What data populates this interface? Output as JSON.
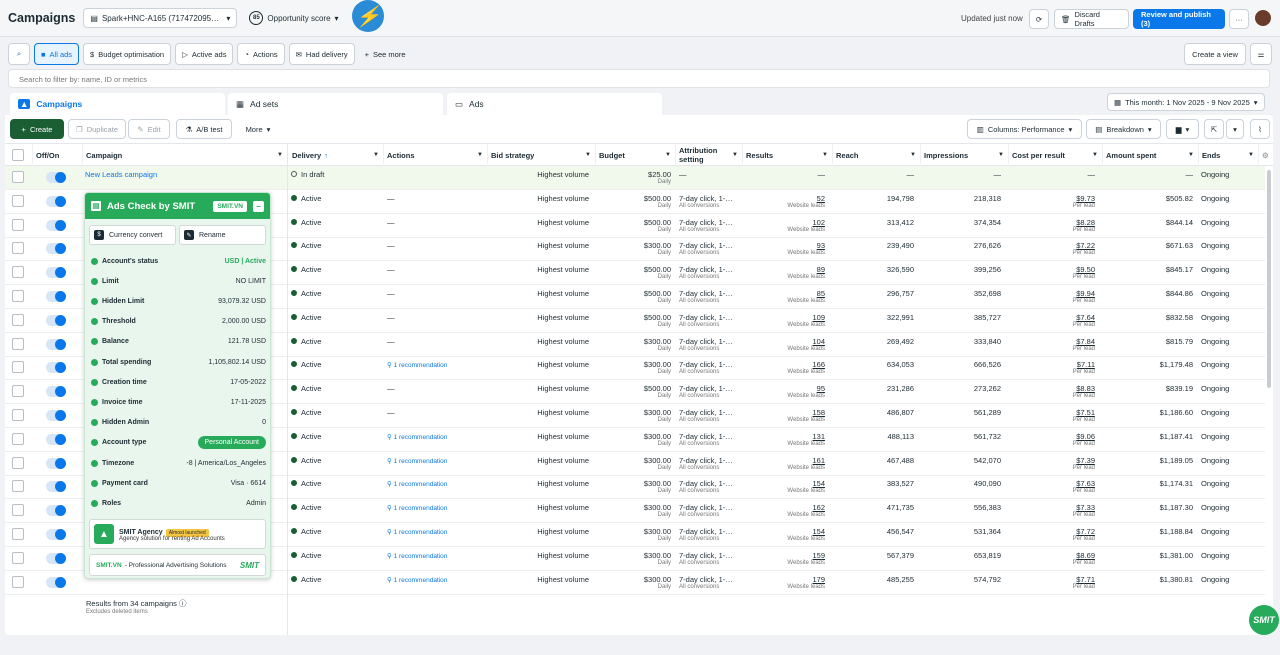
{
  "topbar": {
    "title": "Campaigns",
    "account": "Spark+HNC-A165 (717472095…",
    "opportunity_score_value": "85",
    "opportunity_score_label": "Opportunity score",
    "updated": "Updated just now",
    "discard": "Discard Drafts",
    "review": "Review and publish (3)",
    "more": "···"
  },
  "filters": {
    "all_ads": "All ads",
    "budget_opt": "Budget optimisation",
    "active_ads": "Active ads",
    "actions": "Actions",
    "had_delivery": "Had delivery",
    "see_more": "See more",
    "create_view": "Create a view"
  },
  "search": {
    "placeholder": "Search to filter by: name, ID or metrics"
  },
  "tabs": {
    "campaigns": "Campaigns",
    "adsets": "Ad sets",
    "ads": "Ads"
  },
  "date_range": "This month: 1 Nov 2025 - 9 Nov 2025",
  "toolbar": {
    "create": "Create",
    "duplicate": "Duplicate",
    "edit": "Edit",
    "ab_test": "A/B test",
    "more": "More",
    "columns": "Columns: Performance",
    "breakdown": "Breakdown"
  },
  "columns": {
    "offon": "Off/On",
    "campaign": "Campaign",
    "delivery": "Delivery",
    "actions": "Actions",
    "bid_strategy": "Bid strategy",
    "budget": "Budget",
    "attribution": "Attribution setting",
    "results": "Results",
    "reach": "Reach",
    "impressions": "Impressions",
    "cost_per_result": "Cost per result",
    "amount_spent": "Amount spent",
    "ends": "Ends"
  },
  "rows": [
    {
      "campaign": "New Leads campaign",
      "delivery": "In draft",
      "action": "",
      "bid": "Highest volume",
      "budget": "$25.00",
      "budget_period": "Daily",
      "attribution": "—",
      "attribution_sub": "",
      "results": "—",
      "results_sub": "",
      "reach": "—",
      "impressions": "—",
      "cpr": "—",
      "cpr_sub": "",
      "spent": "—",
      "ends": "Ongoing"
    },
    {
      "campaign": "",
      "delivery": "Active",
      "action": "—",
      "bid": "Highest volume",
      "budget": "$500.00",
      "budget_period": "Daily",
      "attribution": "7-day click, 1-…",
      "attribution_sub": "All conversions",
      "results": "52",
      "results_sub": "Website leads",
      "reach": "194,798",
      "impressions": "218,318",
      "cpr": "$9.73",
      "cpr_sub": "Per lead",
      "spent": "$505.82",
      "ends": "Ongoing"
    },
    {
      "campaign": "",
      "delivery": "Active",
      "action": "—",
      "bid": "Highest volume",
      "budget": "$500.00",
      "budget_period": "Daily",
      "attribution": "7-day click, 1-…",
      "attribution_sub": "All conversions",
      "results": "102",
      "results_sub": "Website leads",
      "reach": "313,412",
      "impressions": "374,354",
      "cpr": "$8.28",
      "cpr_sub": "Per lead",
      "spent": "$844.14",
      "ends": "Ongoing"
    },
    {
      "campaign": "",
      "delivery": "Active",
      "action": "—",
      "bid": "Highest volume",
      "budget": "$300.00",
      "budget_period": "Daily",
      "attribution": "7-day click, 1-…",
      "attribution_sub": "All conversions",
      "results": "93",
      "results_sub": "Website leads",
      "reach": "239,490",
      "impressions": "276,626",
      "cpr": "$7.22",
      "cpr_sub": "Per lead",
      "spent": "$671.63",
      "ends": "Ongoing"
    },
    {
      "campaign": "",
      "delivery": "Active",
      "action": "—",
      "bid": "Highest volume",
      "budget": "$500.00",
      "budget_period": "Daily",
      "attribution": "7-day click, 1-…",
      "attribution_sub": "All conversions",
      "results": "89",
      "results_sub": "Website leads",
      "reach": "326,590",
      "impressions": "399,256",
      "cpr": "$9.50",
      "cpr_sub": "Per lead",
      "spent": "$845.17",
      "ends": "Ongoing"
    },
    {
      "campaign": "",
      "delivery": "Active",
      "action": "—",
      "bid": "Highest volume",
      "budget": "$500.00",
      "budget_period": "Daily",
      "attribution": "7-day click, 1-…",
      "attribution_sub": "All conversions",
      "results": "85",
      "results_sub": "Website leads",
      "reach": "296,757",
      "impressions": "352,698",
      "cpr": "$9.94",
      "cpr_sub": "Per lead",
      "spent": "$844.86",
      "ends": "Ongoing"
    },
    {
      "campaign": "",
      "delivery": "Active",
      "action": "—",
      "bid": "Highest volume",
      "budget": "$500.00",
      "budget_period": "Daily",
      "attribution": "7-day click, 1-…",
      "attribution_sub": "All conversions",
      "results": "109",
      "results_sub": "Website leads",
      "reach": "322,991",
      "impressions": "385,727",
      "cpr": "$7.64",
      "cpr_sub": "Per lead",
      "spent": "$832.58",
      "ends": "Ongoing"
    },
    {
      "campaign": "",
      "delivery": "Active",
      "action": "—",
      "bid": "Highest volume",
      "budget": "$300.00",
      "budget_period": "Daily",
      "attribution": "7-day click, 1-…",
      "attribution_sub": "All conversions",
      "results": "104",
      "results_sub": "Website leads",
      "reach": "269,492",
      "impressions": "333,840",
      "cpr": "$7.84",
      "cpr_sub": "Per lead",
      "spent": "$815.79",
      "ends": "Ongoing"
    },
    {
      "campaign": "",
      "delivery": "Active",
      "action": "1 recommendation",
      "bid": "Highest volume",
      "budget": "$300.00",
      "budget_period": "Daily",
      "attribution": "7-day click, 1-…",
      "attribution_sub": "All conversions",
      "results": "166",
      "results_sub": "Website leads",
      "reach": "634,053",
      "impressions": "666,526",
      "cpr": "$7.11",
      "cpr_sub": "Per lead",
      "spent": "$1,179.48",
      "ends": "Ongoing"
    },
    {
      "campaign": "",
      "delivery": "Active",
      "action": "—",
      "bid": "Highest volume",
      "budget": "$500.00",
      "budget_period": "Daily",
      "attribution": "7-day click, 1-…",
      "attribution_sub": "All conversions",
      "results": "95",
      "results_sub": "Website leads",
      "reach": "231,286",
      "impressions": "273,262",
      "cpr": "$8.83",
      "cpr_sub": "Per lead",
      "spent": "$839.19",
      "ends": "Ongoing"
    },
    {
      "campaign": "",
      "delivery": "Active",
      "action": "—",
      "bid": "Highest volume",
      "budget": "$300.00",
      "budget_period": "Daily",
      "attribution": "7-day click, 1-…",
      "attribution_sub": "All conversions",
      "results": "158",
      "results_sub": "Website leads",
      "reach": "486,807",
      "impressions": "561,289",
      "cpr": "$7.51",
      "cpr_sub": "Per lead",
      "spent": "$1,186.60",
      "ends": "Ongoing"
    },
    {
      "campaign": "",
      "delivery": "Active",
      "action": "1 recommendation",
      "bid": "Highest volume",
      "budget": "$300.00",
      "budget_period": "Daily",
      "attribution": "7-day click, 1-…",
      "attribution_sub": "All conversions",
      "results": "131",
      "results_sub": "Website leads",
      "reach": "488,113",
      "impressions": "561,732",
      "cpr": "$9.06",
      "cpr_sub": "Per lead",
      "spent": "$1,187.41",
      "ends": "Ongoing"
    },
    {
      "campaign": "",
      "delivery": "Active",
      "action": "1 recommendation",
      "bid": "Highest volume",
      "budget": "$300.00",
      "budget_period": "Daily",
      "attribution": "7-day click, 1-…",
      "attribution_sub": "All conversions",
      "results": "161",
      "results_sub": "Website leads",
      "reach": "467,488",
      "impressions": "542,070",
      "cpr": "$7.39",
      "cpr_sub": "Per lead",
      "spent": "$1,189.05",
      "ends": "Ongoing"
    },
    {
      "campaign": "",
      "delivery": "Active",
      "action": "1 recommendation",
      "bid": "Highest volume",
      "budget": "$300.00",
      "budget_period": "Daily",
      "attribution": "7-day click, 1-…",
      "attribution_sub": "All conversions",
      "results": "154",
      "results_sub": "Website leads",
      "reach": "383,527",
      "impressions": "490,090",
      "cpr": "$7.63",
      "cpr_sub": "Per lead",
      "spent": "$1,174.31",
      "ends": "Ongoing"
    },
    {
      "campaign": "",
      "delivery": "Active",
      "action": "1 recommendation",
      "bid": "Highest volume",
      "budget": "$300.00",
      "budget_period": "Daily",
      "attribution": "7-day click, 1-…",
      "attribution_sub": "All conversions",
      "results": "162",
      "results_sub": "Website leads",
      "reach": "471,735",
      "impressions": "556,383",
      "cpr": "$7.33",
      "cpr_sub": "Per lead",
      "spent": "$1,187.30",
      "ends": "Ongoing"
    },
    {
      "campaign": "",
      "delivery": "Active",
      "action": "1 recommendation",
      "bid": "Highest volume",
      "budget": "$300.00",
      "budget_period": "Daily",
      "attribution": "7-day click, 1-…",
      "attribution_sub": "All conversions",
      "results": "154",
      "results_sub": "Website leads",
      "reach": "456,547",
      "impressions": "531,364",
      "cpr": "$7.72",
      "cpr_sub": "Per lead",
      "spent": "$1,188.84",
      "ends": "Ongoing"
    },
    {
      "campaign": "",
      "delivery": "Active",
      "action": "1 recommendation",
      "bid": "Highest volume",
      "budget": "$300.00",
      "budget_period": "Daily",
      "attribution": "7-day click, 1-…",
      "attribution_sub": "All conversions",
      "results": "159",
      "results_sub": "Website leads",
      "reach": "567,379",
      "impressions": "653,819",
      "cpr": "$8.69",
      "cpr_sub": "Per lead",
      "spent": "$1,381.00",
      "ends": "Ongoing"
    },
    {
      "campaign": "",
      "delivery": "Active",
      "action": "1 recommendation",
      "bid": "Highest volume",
      "budget": "$300.00",
      "budget_period": "Daily",
      "attribution": "7-day click, 1-…",
      "attribution_sub": "All conversions",
      "results": "179",
      "results_sub": "Website leads",
      "reach": "485,255",
      "impressions": "574,792",
      "cpr": "$7.71",
      "cpr_sub": "Per lead",
      "spent": "$1,380.81",
      "ends": "Ongoing"
    }
  ],
  "footer": {
    "results": "Results from 34 campaigns",
    "excludes": "Excludes deleted items"
  },
  "panel": {
    "title": "Ads Check by SMIT",
    "badge": "SMIT.VN",
    "currency_convert": "Currency convert",
    "rename": "Rename",
    "items": [
      {
        "k": "Account's status",
        "v": "USD | Active"
      },
      {
        "k": "Limit",
        "v": "NO LIMIT"
      },
      {
        "k": "Hidden Limit",
        "v": "93,079.32 USD"
      },
      {
        "k": "Threshold",
        "v": "2,000.00 USD"
      },
      {
        "k": "Balance",
        "v": "121.78 USD"
      },
      {
        "k": "Total spending",
        "v": "1,105,802.14 USD"
      },
      {
        "k": "Creation time",
        "v": "17-05-2022"
      },
      {
        "k": "Invoice time",
        "v": "17-11-2025"
      },
      {
        "k": "Hidden Admin",
        "v": "0"
      },
      {
        "k": "Account type",
        "v": "Personal Account"
      },
      {
        "k": "Timezone",
        "v": "-8 | America/Los_Angeles"
      },
      {
        "k": "Payment card",
        "v": "Visa · 6614"
      },
      {
        "k": "Roles",
        "v": "Admin"
      }
    ],
    "agency_title": "SMIT Agency",
    "agency_tag": "Almost launched",
    "agency_sub": "Agency solution for renting Ad Accounts",
    "footer_a": "SMIT.VN",
    "footer_b": "- Professional Advertising Solutions",
    "footer_brand": "SMIT"
  },
  "fab": "SMIT",
  "colors": {
    "accent": "#0a78e8",
    "active_green": "#1b5e34",
    "smit_green": "#27ab5b"
  }
}
